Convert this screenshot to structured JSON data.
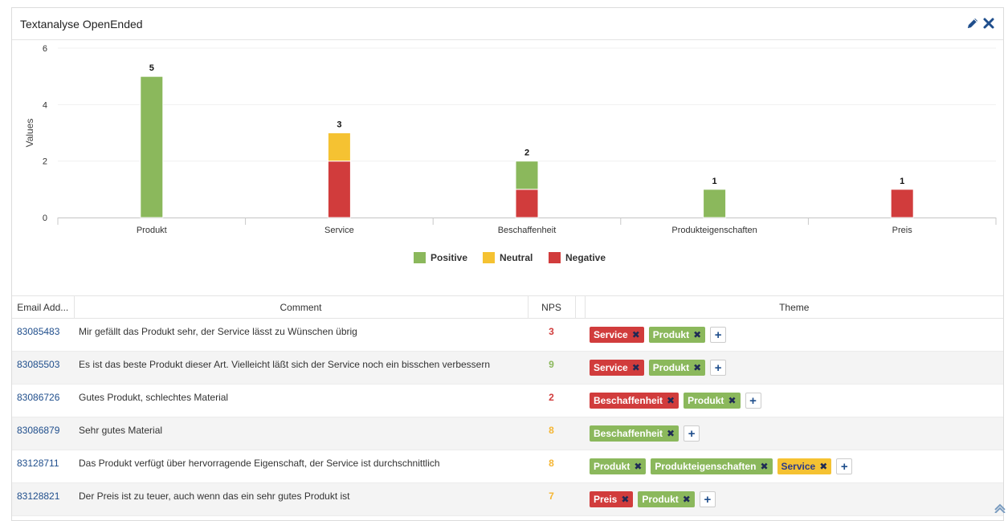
{
  "panel": {
    "title": "Textanalyse OpenEnded",
    "edit_icon": "pencil-icon",
    "close_icon": "close-icon"
  },
  "colors": {
    "positive": "#8bb85c",
    "neutral": "#f5c232",
    "negative": "#d13c3c",
    "link": "#1f4e8c"
  },
  "chart_data": {
    "type": "bar",
    "stacked": true,
    "categories": [
      "Produkt",
      "Service",
      "Beschaffenheit",
      "Produkteigenschaften",
      "Preis"
    ],
    "series": [
      {
        "name": "Positive",
        "color": "#8bb85c",
        "values": [
          5,
          0,
          1,
          1,
          0
        ]
      },
      {
        "name": "Neutral",
        "color": "#f5c232",
        "values": [
          0,
          1,
          0,
          0,
          0
        ]
      },
      {
        "name": "Negative",
        "color": "#d13c3c",
        "values": [
          0,
          2,
          1,
          0,
          1
        ]
      }
    ],
    "totals": [
      5,
      3,
      2,
      1,
      1
    ],
    "ylabel": "Values",
    "xlabel": "",
    "ylim": [
      0,
      6
    ],
    "yticks": [
      0,
      2,
      4,
      6
    ],
    "grid": true,
    "legend_position": "bottom"
  },
  "table": {
    "columns": [
      "Email Add...",
      "Comment",
      "NPS",
      "",
      "Theme"
    ],
    "rows": [
      {
        "email": "83085483",
        "comment": "Mir gefällt das Produkt sehr, der Service lässt zu Wünschen übrig",
        "nps": "3",
        "nps_color": "#d13c3c",
        "themes": [
          {
            "label": "Service",
            "sentiment": "negative"
          },
          {
            "label": "Produkt",
            "sentiment": "positive"
          }
        ]
      },
      {
        "email": "83085503",
        "comment": "Es ist das beste Produkt dieser Art. Vielleicht läßt sich der Service noch ein bisschen verbessern",
        "nps": "9",
        "nps_color": "#8bb85c",
        "themes": [
          {
            "label": "Service",
            "sentiment": "negative"
          },
          {
            "label": "Produkt",
            "sentiment": "positive"
          }
        ]
      },
      {
        "email": "83086726",
        "comment": "Gutes Produkt, schlechtes Material",
        "nps": "2",
        "nps_color": "#d13c3c",
        "themes": [
          {
            "label": "Beschaffenheit",
            "sentiment": "negative"
          },
          {
            "label": "Produkt",
            "sentiment": "positive"
          }
        ]
      },
      {
        "email": "83086879",
        "comment": "Sehr gutes Material",
        "nps": "8",
        "nps_color": "#f5b532",
        "themes": [
          {
            "label": "Beschaffenheit",
            "sentiment": "positive"
          }
        ]
      },
      {
        "email": "83128711",
        "comment": "Das Produkt verfügt über hervorragende Eigenschaft, der Service ist durchschnittlich",
        "nps": "8",
        "nps_color": "#f5b532",
        "themes": [
          {
            "label": "Produkt",
            "sentiment": "positive"
          },
          {
            "label": "Produkteigenschaften",
            "sentiment": "positive"
          },
          {
            "label": "Service",
            "sentiment": "neutral"
          }
        ]
      },
      {
        "email": "83128821",
        "comment": "Der Preis ist zu teuer, auch wenn das ein sehr gutes Produkt ist",
        "nps": "7",
        "nps_color": "#f5b532",
        "themes": [
          {
            "label": "Preis",
            "sentiment": "negative"
          },
          {
            "label": "Produkt",
            "sentiment": "positive"
          }
        ]
      }
    ],
    "remove_tag_icon": "close-icon",
    "add_theme_icon": "plus-icon"
  }
}
